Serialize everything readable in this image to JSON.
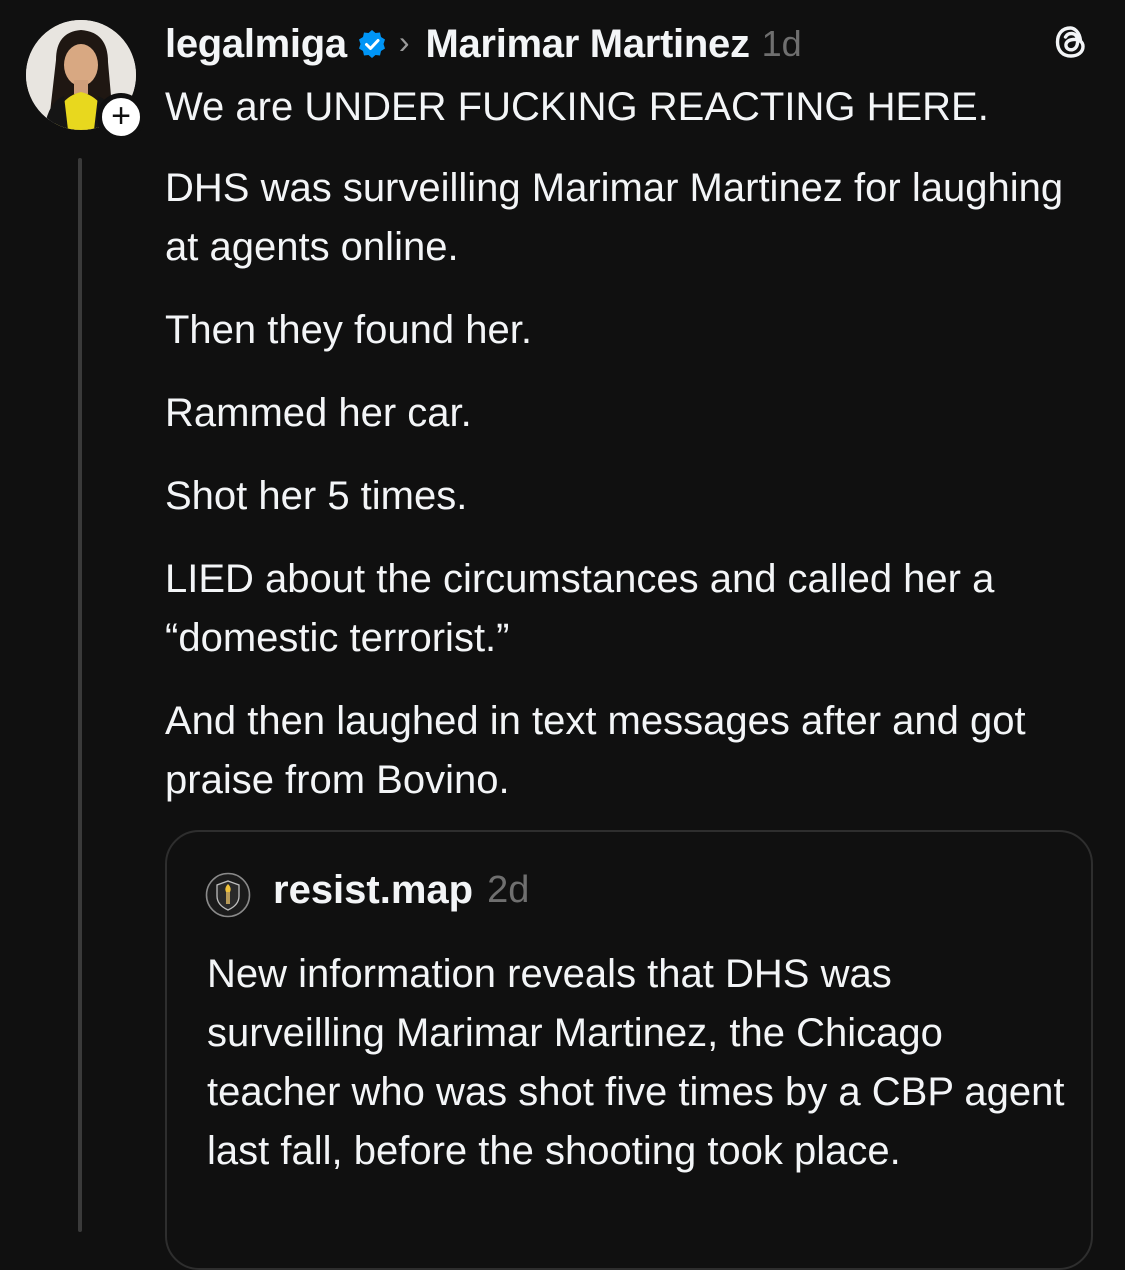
{
  "post": {
    "username": "legalmiga",
    "reply_to": "Marimar Martinez",
    "time": "1d",
    "follow_symbol": "+",
    "paragraphs": [
      "We are UNDER FUCKING REACTING HERE.",
      "DHS was surveilling Marimar Martinez for laughing at agents online.",
      "Then they found her.",
      "Rammed her car.",
      "Shot her 5 times.",
      "LIED about the circumstances and called her a “domestic terrorist.”",
      "And then laughed in text messages after and got praise from Bovino."
    ]
  },
  "quote": {
    "username": "resist.map",
    "time": "2d",
    "text": "New information reveals that DHS was surveilling Marimar Martinez, the Chicago teacher who was shot five times by a CBP agent last fall, before the shooting took place."
  },
  "colors": {
    "background": "#101010",
    "text": "#f3f5f7",
    "muted": "#6f6f6f",
    "verified": "#0095f6",
    "border": "#2e2e2e"
  },
  "icons": {
    "verified": "verified-badge-icon",
    "chevron": "chevron-right-icon",
    "threads": "threads-logo-icon"
  }
}
